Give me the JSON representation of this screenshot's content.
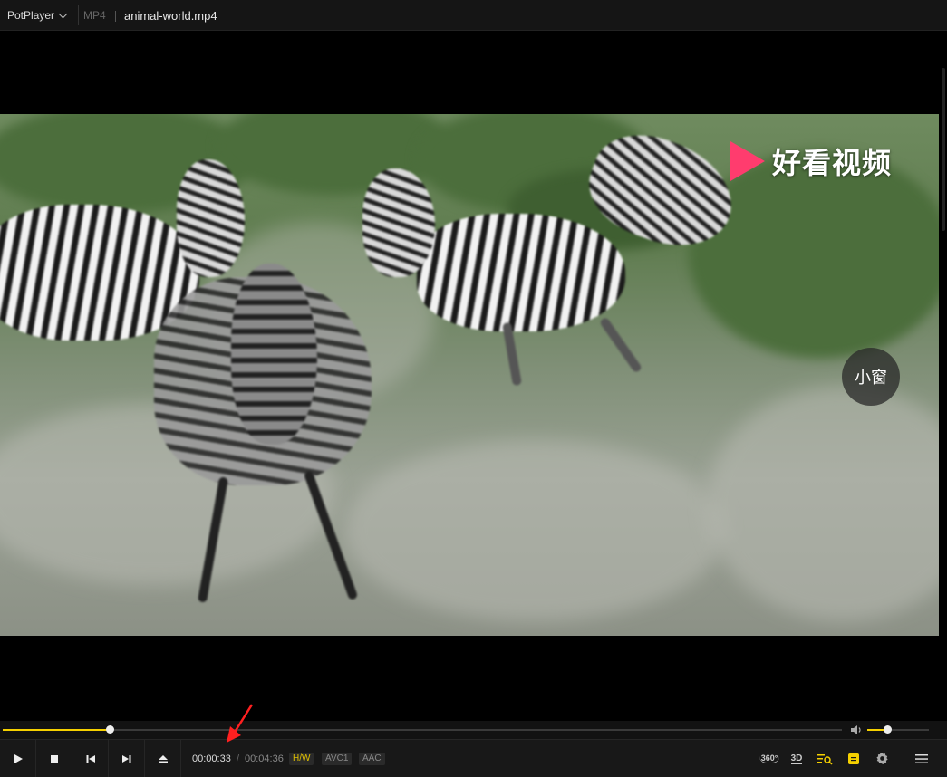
{
  "titlebar": {
    "app_name": "PotPlayer",
    "format": "MP4",
    "filename": "animal-world.mp4"
  },
  "video": {
    "watermark_text": "好看视频",
    "mini_window_label": "小窗"
  },
  "playback": {
    "current_time": "00:00:33",
    "separator": "/",
    "duration": "00:04:36",
    "progress_fraction": 0.127,
    "volume_fraction": 0.32
  },
  "badges": {
    "hw": "H/W",
    "video_codec": "AVC1",
    "audio_codec": "AAC"
  },
  "right_controls": {
    "vr_label": "360°",
    "threed_label": "3D"
  },
  "icons": [
    "chevron-down-icon",
    "play-icon",
    "stop-icon",
    "previous-icon",
    "next-icon",
    "eject-icon",
    "volume-icon",
    "360-icon",
    "3d-icon",
    "playlist-search-icon",
    "subtitle-icon",
    "gear-icon",
    "menu-icon"
  ],
  "colors": {
    "accent": "#f5d000",
    "annotation_arrow": "#ff2020"
  }
}
